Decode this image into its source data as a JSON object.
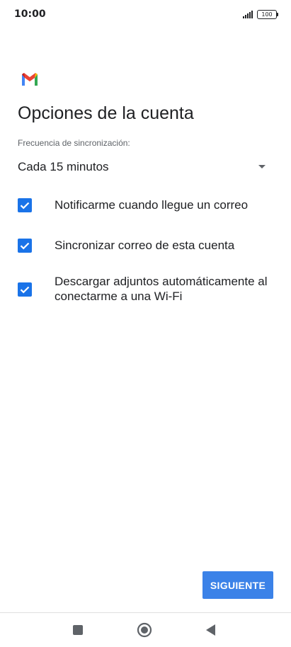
{
  "status_bar": {
    "time": "10:00",
    "battery": "100"
  },
  "header": {
    "app_icon": "gmail-logo-icon",
    "title": "Opciones de la cuenta"
  },
  "sync": {
    "label": "Frecuencia de sincronización:",
    "selected_value": "Cada 15 minutos"
  },
  "options": [
    {
      "label": "Notificarme cuando llegue un correo",
      "checked": true
    },
    {
      "label": "Sincronizar correo de esta cuenta",
      "checked": true
    },
    {
      "label": "Descargar adjuntos automáticamente al conectarme a una Wi-Fi",
      "checked": true
    }
  ],
  "actions": {
    "next_label": "SIGUIENTE"
  },
  "nav_bar": {
    "buttons": [
      "recents-icon",
      "home-icon",
      "back-icon"
    ]
  },
  "colors": {
    "accent": "#1a73e8",
    "button": "#3b82e8"
  }
}
